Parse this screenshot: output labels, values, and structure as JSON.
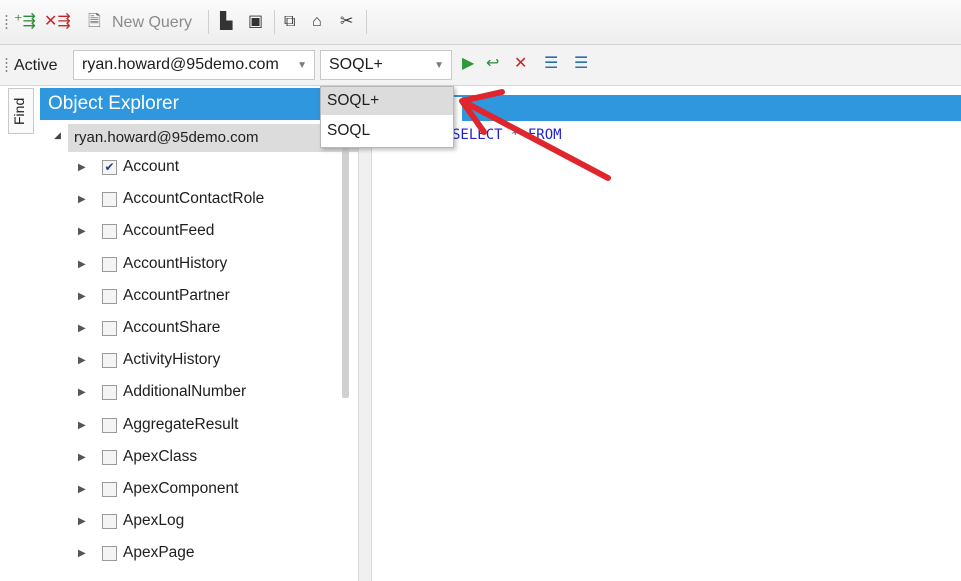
{
  "toolbar1": {
    "new_query_label": "New Query",
    "icons": [
      "add-connection-icon",
      "remove-connection-icon",
      "new-query-icon",
      "open-icon",
      "save-icon",
      "copy-icon",
      "paste-icon",
      "cut-icon"
    ]
  },
  "toolbar2": {
    "active_label": "Active",
    "connection_value": "ryan.howard@95demo.com",
    "language_value": "SOQL+",
    "icons": [
      "run-icon",
      "step-icon",
      "stop-icon",
      "indent-icon",
      "outdent-icon"
    ]
  },
  "find_tab": {
    "label": "Find"
  },
  "object_explorer": {
    "title": "Object Explorer",
    "root": "ryan.howard@95demo.com",
    "items": [
      {
        "name": "Account",
        "checked": true
      },
      {
        "name": "AccountContactRole",
        "checked": false
      },
      {
        "name": "AccountFeed",
        "checked": false
      },
      {
        "name": "AccountHistory",
        "checked": false
      },
      {
        "name": "AccountPartner",
        "checked": false
      },
      {
        "name": "AccountShare",
        "checked": false
      },
      {
        "name": "ActivityHistory",
        "checked": false
      },
      {
        "name": "AdditionalNumber",
        "checked": false
      },
      {
        "name": "AggregateResult",
        "checked": false
      },
      {
        "name": "ApexClass",
        "checked": false
      },
      {
        "name": "ApexComponent",
        "checked": false
      },
      {
        "name": "ApexLog",
        "checked": false
      },
      {
        "name": "ApexPage",
        "checked": false
      }
    ]
  },
  "editor": {
    "code": "SELECT * FROM"
  },
  "language_dropdown": {
    "options": [
      "SOQL+",
      "SOQL"
    ],
    "highlighted": "SOQL+"
  },
  "colors": {
    "accent": "#2f97de",
    "annotation_arrow": "#e0262c",
    "keyword": "#2222cc"
  }
}
